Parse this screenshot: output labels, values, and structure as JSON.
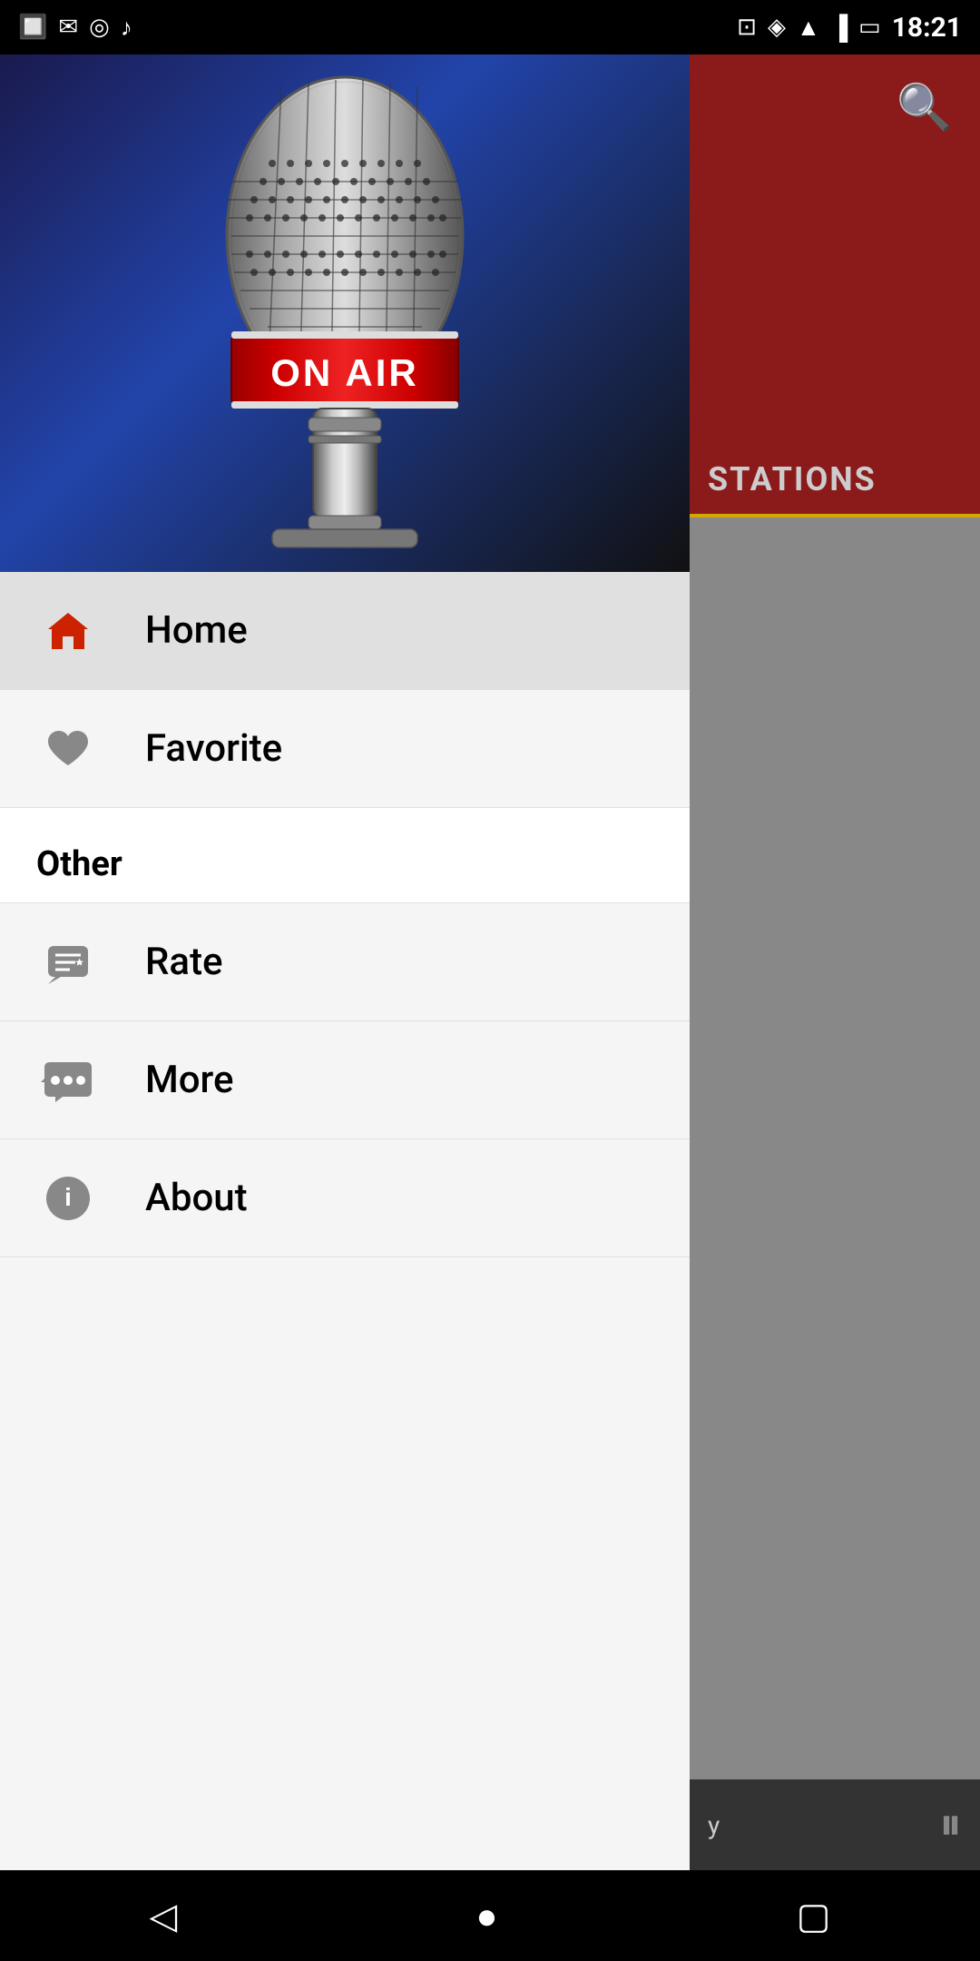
{
  "statusBar": {
    "time": "18:21",
    "leftIcons": [
      "app-icon",
      "gmail-icon",
      "camera-icon",
      "music-icon"
    ],
    "rightIcons": [
      "cast-icon",
      "nav-icon",
      "wifi-icon",
      "signal-icon",
      "battery-icon"
    ]
  },
  "hero": {
    "altText": "ON AIR microphone"
  },
  "menu": {
    "items": [
      {
        "id": "home",
        "label": "Home",
        "icon": "home-icon",
        "active": true
      },
      {
        "id": "favorite",
        "label": "Favorite",
        "icon": "heart-icon",
        "active": false
      }
    ],
    "sections": [
      {
        "header": "Other",
        "items": [
          {
            "id": "rate",
            "label": "Rate",
            "icon": "rate-icon"
          },
          {
            "id": "more",
            "label": "More",
            "icon": "more-icon"
          },
          {
            "id": "about",
            "label": "About",
            "icon": "info-icon"
          }
        ]
      }
    ]
  },
  "rightPanel": {
    "stationsLabel": "STATIONS"
  },
  "player": {
    "songLabel": "y"
  },
  "navbar": {
    "back": "◁",
    "home": "●",
    "recent": "▢"
  }
}
